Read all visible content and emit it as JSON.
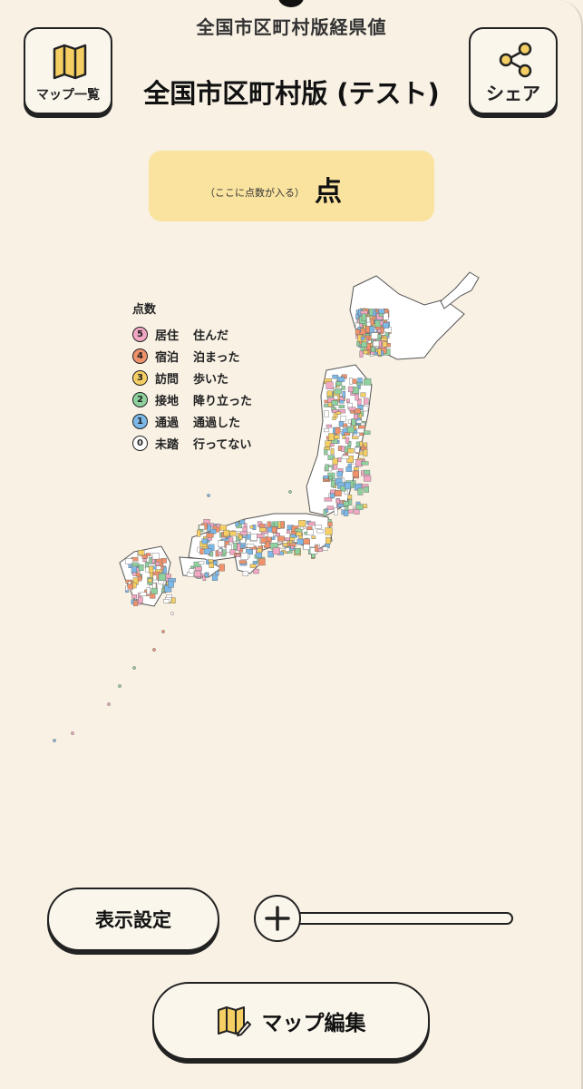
{
  "header": {
    "app_title": "全国市区町村版経県値",
    "page_title": "全国市区町村版 (テスト)",
    "map_list_label": "マップ一覧",
    "share_label": "シェア"
  },
  "score": {
    "placeholder_note": "（ここに点数が入る）",
    "unit": "点"
  },
  "legend": {
    "title": "点数",
    "items": [
      {
        "score": "5",
        "name": "居住",
        "desc": "住んだ",
        "color": "#f2a7c3"
      },
      {
        "score": "4",
        "name": "宿泊",
        "desc": "泊まった",
        "color": "#f0926c"
      },
      {
        "score": "3",
        "name": "訪問",
        "desc": "歩いた",
        "color": "#f5cf63"
      },
      {
        "score": "2",
        "name": "接地",
        "desc": "降り立った",
        "color": "#8fd19e"
      },
      {
        "score": "1",
        "name": "通過",
        "desc": "通過した",
        "color": "#7cb8e8"
      },
      {
        "score": "0",
        "name": "未踏",
        "desc": "行ってない",
        "color": "#ffffff"
      }
    ]
  },
  "controls": {
    "display_settings_label": "表示設定",
    "map_edit_label": "マップ編集"
  },
  "colors": {
    "background": "#f8f1e4",
    "score_box": "#fae39f",
    "icon_yellow": "#f5cf63",
    "outline": "#222222"
  }
}
